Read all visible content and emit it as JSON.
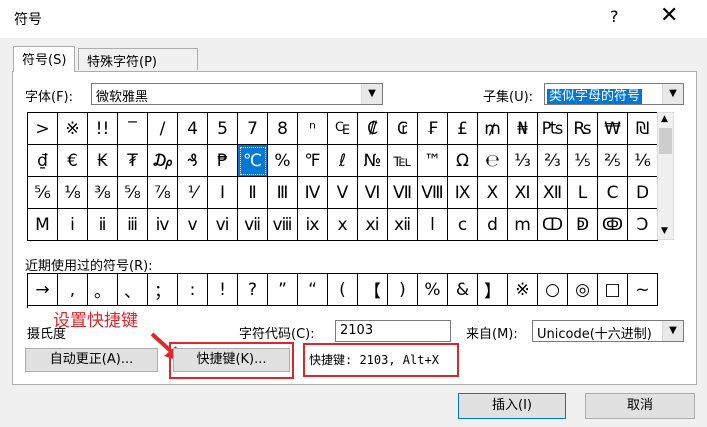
{
  "window": {
    "title": "符号",
    "help": "?",
    "close": "✕"
  },
  "tabs": [
    {
      "label": "符号(S)"
    },
    {
      "label": "特殊字符(P)"
    }
  ],
  "font": {
    "label": "字体(F):",
    "value": "微软雅黑"
  },
  "subset": {
    "label": "子集(U):",
    "value": "类似字母的符号"
  },
  "grid_rows": [
    [
      ">",
      "※",
      "!!",
      "‾",
      "/",
      "4",
      "5",
      "7",
      "8",
      "ⁿ",
      "₠",
      "₡",
      "₢",
      "₣",
      "£",
      "₥",
      "₦",
      "₧",
      "₨",
      "₩",
      "₪"
    ],
    [
      "₫",
      "€",
      "₭",
      "₮",
      "₯",
      "₰",
      "₱",
      "℃",
      "%",
      "℉",
      "ℓ",
      "№",
      "℡",
      "™",
      "Ω",
      "℮",
      "⅓",
      "⅔",
      "⅕",
      "⅖",
      "⅙"
    ],
    [
      "⅚",
      "⅛",
      "⅜",
      "⅝",
      "⅞",
      "⅟",
      "Ⅰ",
      "Ⅱ",
      "Ⅲ",
      "Ⅳ",
      "Ⅴ",
      "Ⅵ",
      "Ⅶ",
      "Ⅷ",
      "Ⅸ",
      "Ⅹ",
      "Ⅺ",
      "Ⅻ",
      "Ⅼ",
      "Ⅽ",
      "Ⅾ"
    ],
    [
      "Ⅿ",
      "ⅰ",
      "ⅱ",
      "ⅲ",
      "ⅳ",
      "ⅴ",
      "ⅵ",
      "ⅶ",
      "ⅷ",
      "ⅸ",
      "ⅹ",
      "ⅺ",
      "ⅻ",
      "ⅼ",
      "ⅽ",
      "ⅾ",
      "ⅿ",
      "ↀ",
      "ↁ",
      "ↂ",
      "Ↄ"
    ]
  ],
  "selected_symbol": "℃",
  "recent": {
    "label": "近期使用过的符号(R):",
    "items": [
      "→",
      ",",
      "。",
      "、",
      "；",
      ":",
      "!",
      "?",
      "”",
      "“",
      "(",
      "【",
      ")",
      "%",
      "&",
      "】",
      "※",
      "○",
      "◎",
      "□",
      "~"
    ]
  },
  "symbol_name": "摄氏度",
  "char_code": {
    "label": "字符代码(C):",
    "value": "2103"
  },
  "from": {
    "label": "来自(M):",
    "value": "Unicode(十六进制)"
  },
  "buttons": {
    "autocorrect": "自动更正(A)...",
    "shortcut": "快捷键(K)...",
    "insert": "插入(I)",
    "cancel": "取消"
  },
  "shortcut_text": "快捷键: 2103, Alt+X",
  "annotation": "设置快捷键",
  "colors": {
    "highlight": "#0078d7",
    "annotation_red": "#e0262b"
  }
}
